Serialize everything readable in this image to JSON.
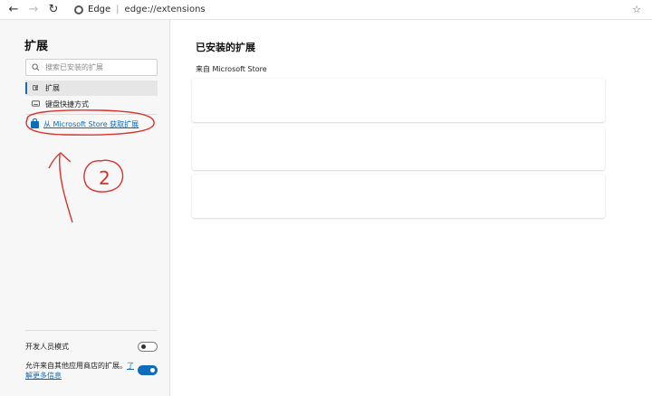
{
  "toolbar": {
    "back": "←",
    "forward": "→",
    "refresh": "↻",
    "browser_name": "Edge",
    "separator": "|",
    "url": "edge://extensions",
    "favorite": "☆"
  },
  "sidebar": {
    "title": "扩展",
    "search_placeholder": "搜索已安装的扩展",
    "items": [
      {
        "label": "扩展",
        "icon": "puzzle-icon",
        "active": true
      },
      {
        "label": "键盘快捷方式",
        "icon": "keyboard-icon",
        "active": false
      }
    ],
    "store_link": "从 Microsoft Store 获取扩展",
    "dev_mode_label": "开发人员模式",
    "allow_other_stores_text": "允许来自其他应用商店的扩展。",
    "learn_more": "了解更多信息"
  },
  "main": {
    "title": "已安装的扩展",
    "section_label": "来自 Microsoft Store",
    "cards": [
      {},
      {},
      {}
    ]
  },
  "annotation": {
    "number": "2",
    "color": "#d9312b"
  },
  "colors": {
    "accent": "#0f6cbd"
  }
}
